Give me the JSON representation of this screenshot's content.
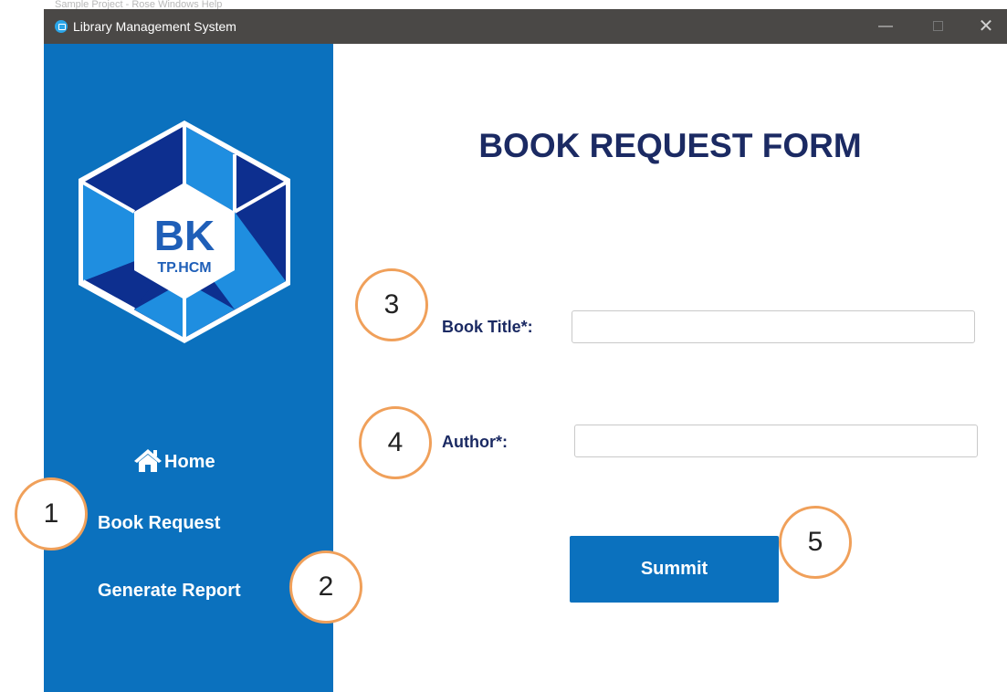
{
  "background_hint": "Sample Project - Rose Windows Help",
  "window": {
    "title": "Library Management System",
    "controls": {
      "minimize": "—",
      "maximize": "",
      "close": "✕"
    }
  },
  "sidebar": {
    "logo": {
      "letters": "BK",
      "subtitle": "TP.HCM"
    },
    "items": [
      {
        "id": "home",
        "label": "Home",
        "icon": "home-icon"
      },
      {
        "id": "book-request",
        "label": "Book Request"
      },
      {
        "id": "generate-report",
        "label": "Generate Report"
      }
    ]
  },
  "form": {
    "heading": "BOOK REQUEST FORM",
    "fields": {
      "book_title": {
        "label": "Book Title*:",
        "value": ""
      },
      "author": {
        "label": "Author*:",
        "value": ""
      }
    },
    "submit_label": "Summit"
  },
  "annotations": [
    "1",
    "2",
    "3",
    "4",
    "5"
  ],
  "colors": {
    "sidebar": "#0b71be",
    "heading": "#1b2a63",
    "marker_border": "#f0a05a",
    "titlebar": "#4a4846",
    "logo_dark": "#0d2f8f",
    "logo_light": "#1f8ee0"
  }
}
